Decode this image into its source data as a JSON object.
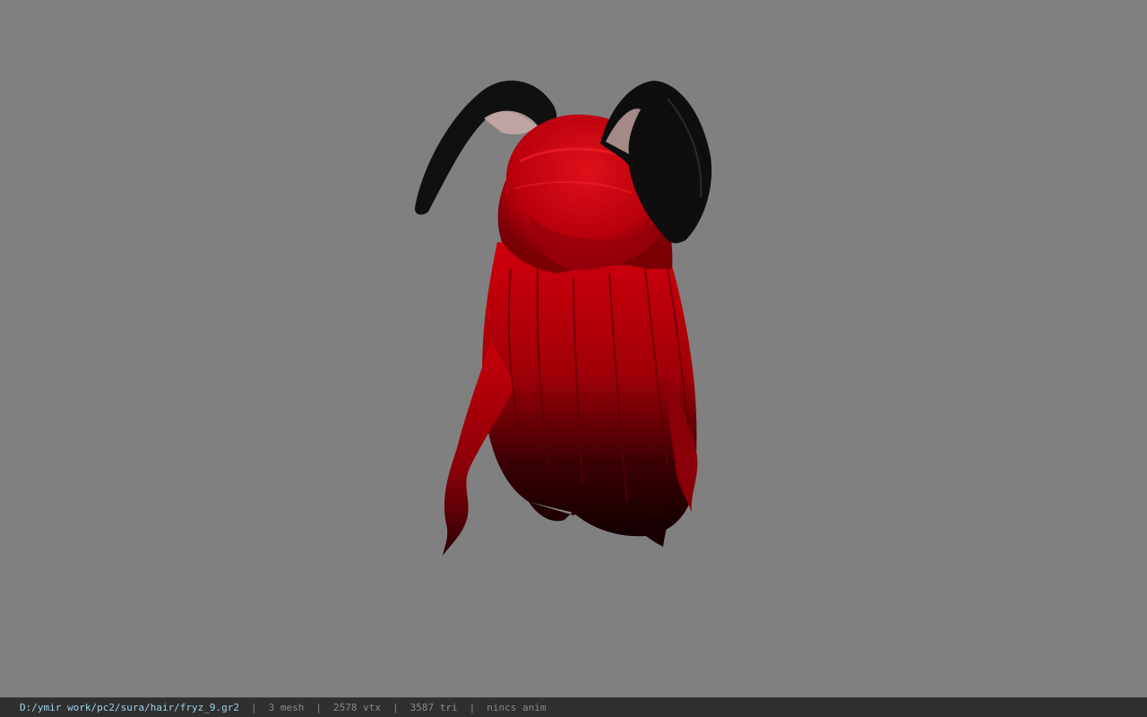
{
  "viewport": {
    "background": "#808080",
    "model": {
      "name": "hair-model",
      "hair_color": "#c80010",
      "ear_color": "#111111",
      "ear_inner_color": "#c9aaa8"
    }
  },
  "statusbar": {
    "path": "D:/ymir work/pc2/sura/hair/fryz_9.gr2",
    "mesh": "3 mesh",
    "vtx": "2578 vtx",
    "tri": "3587 tri",
    "anim": "nincs anim",
    "separator": "|"
  }
}
